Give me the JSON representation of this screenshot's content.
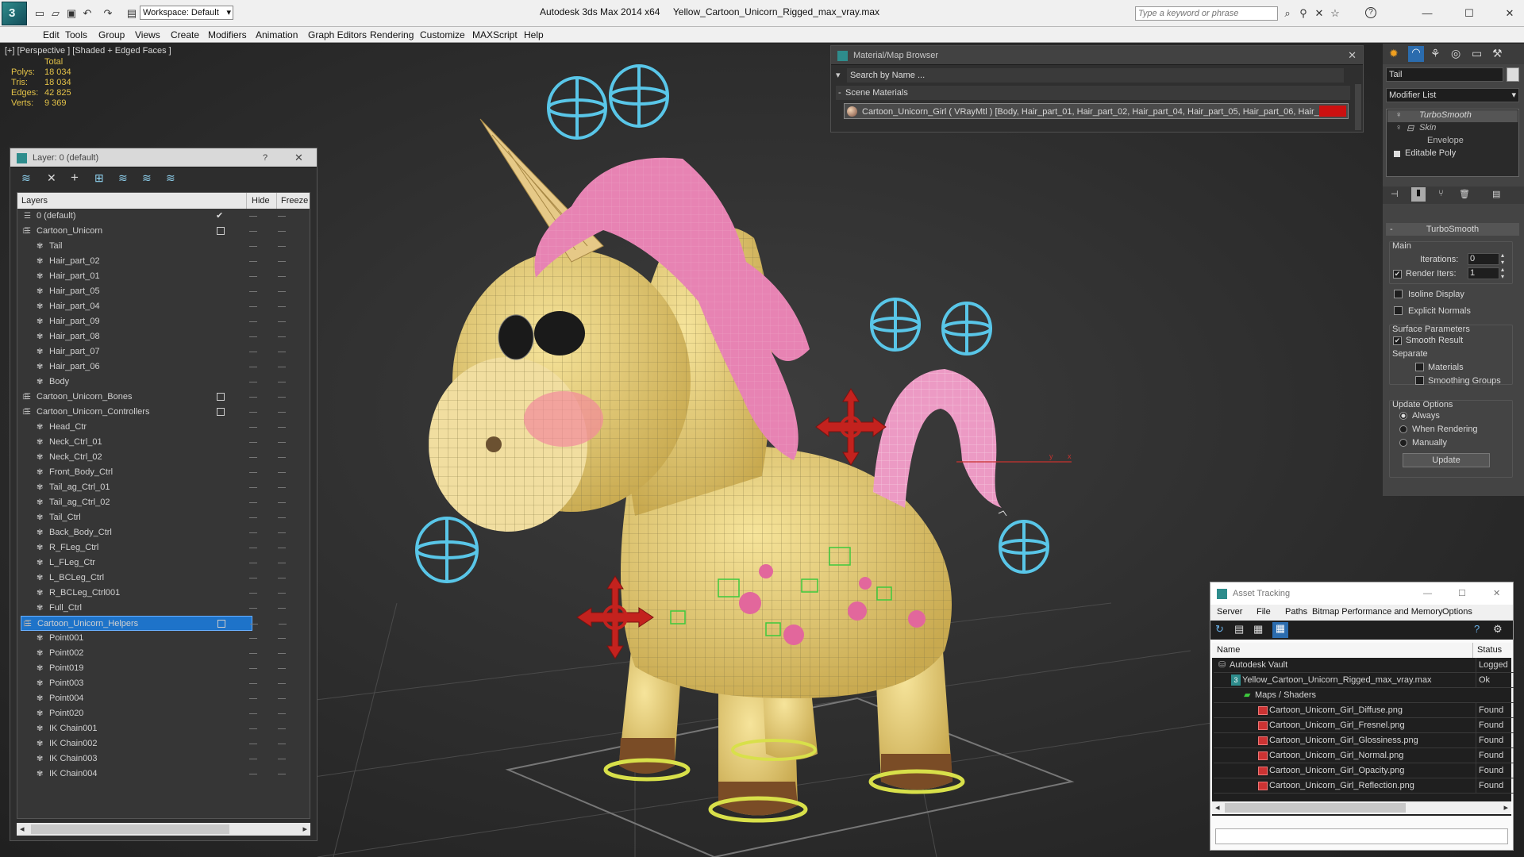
{
  "app": {
    "title": "Autodesk 3ds Max  2014 x64",
    "file": "Yellow_Cartoon_Unicorn_Rigged_max_vray.max",
    "workspace": "Workspace: Default",
    "search_placeholder": "Type a keyword or phrase"
  },
  "menu": [
    "Edit",
    "Tools",
    "Group",
    "Views",
    "Create",
    "Modifiers",
    "Animation",
    "Graph Editors",
    "Rendering",
    "Customize",
    "MAXScript",
    "Help"
  ],
  "viewport": {
    "label": "[+] [Perspective ] [Shaded + Edged Faces ]",
    "stats": {
      "header": "Total",
      "rows": [
        {
          "k": "Polys:",
          "v": "18 034"
        },
        {
          "k": "Tris:",
          "v": "18 034"
        },
        {
          "k": "Edges:",
          "v": "42 825"
        },
        {
          "k": "Verts:",
          "v": "9 369"
        }
      ]
    },
    "axis_x": "x",
    "axis_y": "y"
  },
  "layer_panel": {
    "title": "Layer: 0 (default)",
    "help": "?",
    "col_layers": "Layers",
    "col_hide": "Hide",
    "col_freeze": "Freeze",
    "rows": [
      {
        "name": "0 (default)",
        "indent": 1,
        "check": true
      },
      {
        "name": "Cartoon_Unicorn",
        "indent": 0,
        "box": true,
        "expand": "-"
      },
      {
        "name": "Tail",
        "indent": 2
      },
      {
        "name": "Hair_part_02",
        "indent": 2
      },
      {
        "name": "Hair_part_01",
        "indent": 2
      },
      {
        "name": "Hair_part_05",
        "indent": 2
      },
      {
        "name": "Hair_part_04",
        "indent": 2
      },
      {
        "name": "Hair_part_09",
        "indent": 2
      },
      {
        "name": "Hair_part_08",
        "indent": 2
      },
      {
        "name": "Hair_part_07",
        "indent": 2
      },
      {
        "name": "Hair_part_06",
        "indent": 2
      },
      {
        "name": "Body",
        "indent": 2
      },
      {
        "name": "Cartoon_Unicorn_Bones",
        "indent": 0,
        "box": true,
        "expand": "+"
      },
      {
        "name": "Cartoon_Unicorn_Controllers",
        "indent": 0,
        "box": true,
        "expand": "-"
      },
      {
        "name": "Head_Ctr",
        "indent": 2
      },
      {
        "name": "Neck_Ctrl_01",
        "indent": 2
      },
      {
        "name": "Neck_Ctrl_02",
        "indent": 2
      },
      {
        "name": "Front_Body_Ctrl",
        "indent": 2
      },
      {
        "name": "Tail_ag_Ctrl_01",
        "indent": 2
      },
      {
        "name": "Tail_ag_Ctrl_02",
        "indent": 2
      },
      {
        "name": "Tail_Ctrl",
        "indent": 2
      },
      {
        "name": "Back_Body_Ctrl",
        "indent": 2
      },
      {
        "name": "R_FLeg_Ctrl",
        "indent": 2
      },
      {
        "name": "L_FLeg_Ctr",
        "indent": 2
      },
      {
        "name": "L_BCLeg_Ctrl",
        "indent": 2
      },
      {
        "name": "R_BCLeg_Ctrl001",
        "indent": 2
      },
      {
        "name": "Full_Ctrl",
        "indent": 2
      },
      {
        "name": "Cartoon_Unicorn_Helpers",
        "indent": 0,
        "box": true,
        "expand": "-",
        "selected": true
      },
      {
        "name": "Point001",
        "indent": 2
      },
      {
        "name": "Point002",
        "indent": 2
      },
      {
        "name": "Point019",
        "indent": 2
      },
      {
        "name": "Point003",
        "indent": 2
      },
      {
        "name": "Point004",
        "indent": 2
      },
      {
        "name": "Point020",
        "indent": 2
      },
      {
        "name": "IK Chain001",
        "indent": 2
      },
      {
        "name": "IK Chain002",
        "indent": 2
      },
      {
        "name": "IK Chain003",
        "indent": 2
      },
      {
        "name": "IK Chain004",
        "indent": 2
      }
    ]
  },
  "material_browser": {
    "title": "Material/Map Browser",
    "search": "Search by Name ...",
    "section": "Scene Materials",
    "item": "Cartoon_Unicorn_Girl  ( VRayMtl ) [Body, Hair_part_01, Hair_part_02, Hair_part_04, Hair_part_05, Hair_part_06, Hair_..."
  },
  "command_panel": {
    "object_name": "Tail",
    "modifier_list": "Modifier List",
    "stack": [
      "TurboSmooth",
      "Skin",
      "Envelope",
      "Editable Poly"
    ],
    "rollout": "TurboSmooth",
    "main": "Main",
    "iterations_label": "Iterations:",
    "iterations": "0",
    "render_iters_label": "Render Iters:",
    "render_iters": "1",
    "isoline": "Isoline Display",
    "explicit": "Explicit Normals",
    "surface": "Surface Parameters",
    "smooth_result": "Smooth Result",
    "separate": "Separate",
    "materials": "Materials",
    "smoothing_groups": "Smoothing Groups",
    "update_options": "Update Options",
    "always": "Always",
    "when_rendering": "When Rendering",
    "manually": "Manually",
    "update": "Update"
  },
  "asset_tracking": {
    "title": "Asset Tracking",
    "menu": [
      "Server",
      "File",
      "Paths",
      "Bitmap Performance and Memory",
      "Options"
    ],
    "col_name": "Name",
    "col_status": "Status",
    "rows": [
      {
        "name": "Autodesk Vault",
        "status": "Logged",
        "indent": 0
      },
      {
        "name": "Yellow_Cartoon_Unicorn_Rigged_max_vray.max",
        "status": "Ok",
        "indent": 1
      },
      {
        "name": "Maps / Shaders",
        "status": "",
        "indent": 2
      },
      {
        "name": "Cartoon_Unicorn_Girl_Diffuse.png",
        "status": "Found",
        "indent": 3
      },
      {
        "name": "Cartoon_Unicorn_Girl_Fresnel.png",
        "status": "Found",
        "indent": 3
      },
      {
        "name": "Cartoon_Unicorn_Girl_Glossiness.png",
        "status": "Found",
        "indent": 3
      },
      {
        "name": "Cartoon_Unicorn_Girl_Normal.png",
        "status": "Found",
        "indent": 3
      },
      {
        "name": "Cartoon_Unicorn_Girl_Opacity.png",
        "status": "Found",
        "indent": 3
      },
      {
        "name": "Cartoon_Unicorn_Girl_Reflection.png",
        "status": "Found",
        "indent": 3
      }
    ]
  },
  "colors": {
    "accent": "#1e73c9",
    "stat_text": "#e3c248",
    "unicorn_body": "#e8d27a",
    "mane": "#e983b5",
    "controller_cyan": "#59c6e8",
    "controller_red": "#c3221e",
    "material_swatch": "#cc1010"
  }
}
